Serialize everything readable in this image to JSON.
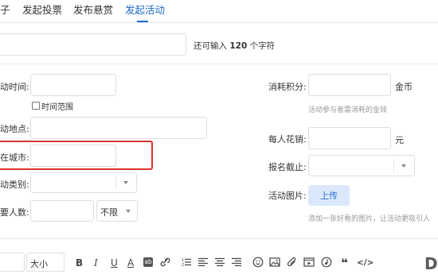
{
  "tabs": [
    {
      "label": "子"
    },
    {
      "label": "发起投票"
    },
    {
      "label": "发布悬赏"
    },
    {
      "label": "发起活动"
    }
  ],
  "title_field": {
    "value": "",
    "remaining_prefix": "还可输入",
    "remaining_count": "120",
    "remaining_suffix": "个字符"
  },
  "form_left": {
    "time_label": "动时间:",
    "time_range_label": "时间范围",
    "location_label": "动地点:",
    "city_label": "在城市:",
    "category_label": "动类别:",
    "people_label": "要人数:",
    "people_unit_option": "不限"
  },
  "form_right": {
    "points_label": "消耗积分:",
    "points_unit": "金币",
    "points_hint": "活动参与者需消耗的金钱",
    "fee_label": "每人花销:",
    "fee_unit": "元",
    "deadline_label": "报名截止:",
    "image_label": "活动图片:",
    "upload_button": "上传",
    "image_hint": "添加一张好看的图片，让活动更吸引人"
  },
  "editor_toolbar": {
    "font_size_label": "大小",
    "bold": "B",
    "italic": "I",
    "underline": "U",
    "font_color": "A",
    "highlight": "ab",
    "quote": "❝",
    "code": "</>"
  },
  "watermark_text": "Di",
  "colors": {
    "accent": "#1e6ac9",
    "highlight_border": "#d9342b",
    "upload_bg": "#dbe8fb"
  }
}
